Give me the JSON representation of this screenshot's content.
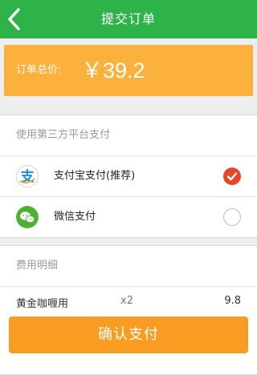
{
  "header": {
    "title": "提交订单"
  },
  "order_total": {
    "label": "订单总价:",
    "value": "￥39.2"
  },
  "third_party": {
    "section_title": "使用第三方平台支付",
    "options": [
      {
        "label": "支付宝支付(推荐)",
        "icon": "alipay-icon",
        "selected": true
      },
      {
        "label": "微信支付",
        "icon": "wechat-icon",
        "selected": false
      }
    ]
  },
  "fees": {
    "section_title": "费用明细",
    "items": [
      {
        "name": "黄金咖喱用",
        "qty": "x2",
        "price": "9.8"
      }
    ]
  },
  "confirm_button": {
    "label": "确认支付"
  },
  "colors": {
    "header_bg": "#2db34a",
    "total_bg": "#fbb13b",
    "confirm_bg": "#f99c22",
    "radio_checked": "#e8462c"
  }
}
